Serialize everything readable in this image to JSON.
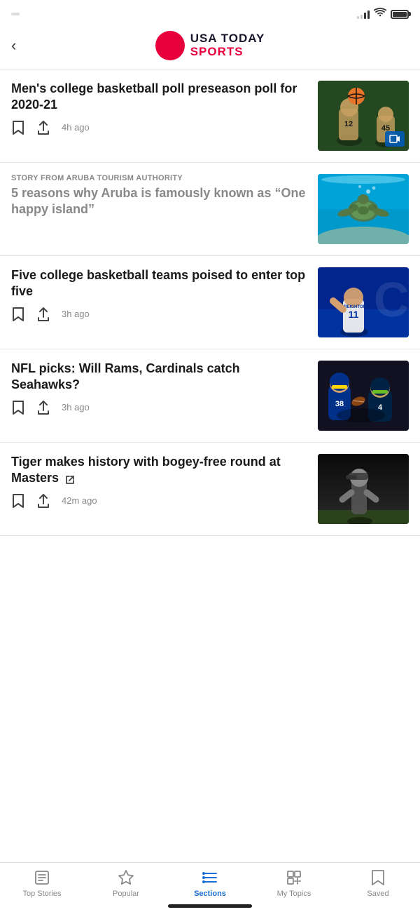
{
  "status": {
    "time": "",
    "signal": "signal",
    "wifi": "wifi",
    "battery": "battery"
  },
  "header": {
    "back_label": "‹",
    "logo_usa": "USA TODAY",
    "logo_sports": "SPORTS"
  },
  "articles": [
    {
      "id": "article-1",
      "sponsor": "",
      "title": "Men's college basketball poll preseason poll for 2020-21",
      "time": "4h ago",
      "thumbnail_type": "basketball",
      "has_video": true,
      "is_sponsored": false
    },
    {
      "id": "article-2",
      "sponsor": "STORY FROM ARUBA TOURISM AUTHORITY",
      "title": "5 reasons why Aruba is famously known as “One happy island”",
      "time": "",
      "thumbnail_type": "aruba",
      "has_video": false,
      "is_sponsored": true
    },
    {
      "id": "article-3",
      "sponsor": "",
      "title": "Five college basketball teams poised to enter top five",
      "time": "3h ago",
      "thumbnail_type": "creighton",
      "has_video": false,
      "is_sponsored": false
    },
    {
      "id": "article-4",
      "sponsor": "",
      "title": "NFL picks: Will Rams, Cardinals catch Seahawks?",
      "time": "3h ago",
      "thumbnail_type": "nfl",
      "has_video": false,
      "is_sponsored": false
    },
    {
      "id": "article-5",
      "sponsor": "",
      "title": "Tiger makes history with bogey-free round at Masters",
      "time": "42m ago",
      "thumbnail_type": "golf",
      "has_video": false,
      "is_sponsored": false,
      "has_external": true
    }
  ],
  "bottom_nav": {
    "items": [
      {
        "id": "top-stories",
        "label": "Top Stories",
        "icon": "list-icon",
        "active": false
      },
      {
        "id": "popular",
        "label": "Popular",
        "icon": "star-icon",
        "active": false
      },
      {
        "id": "sections",
        "label": "Sections",
        "icon": "sections-icon",
        "active": true
      },
      {
        "id": "my-topics",
        "label": "My Topics",
        "icon": "topics-icon",
        "active": false
      },
      {
        "id": "saved",
        "label": "Saved",
        "icon": "bookmark-icon",
        "active": false
      }
    ]
  }
}
